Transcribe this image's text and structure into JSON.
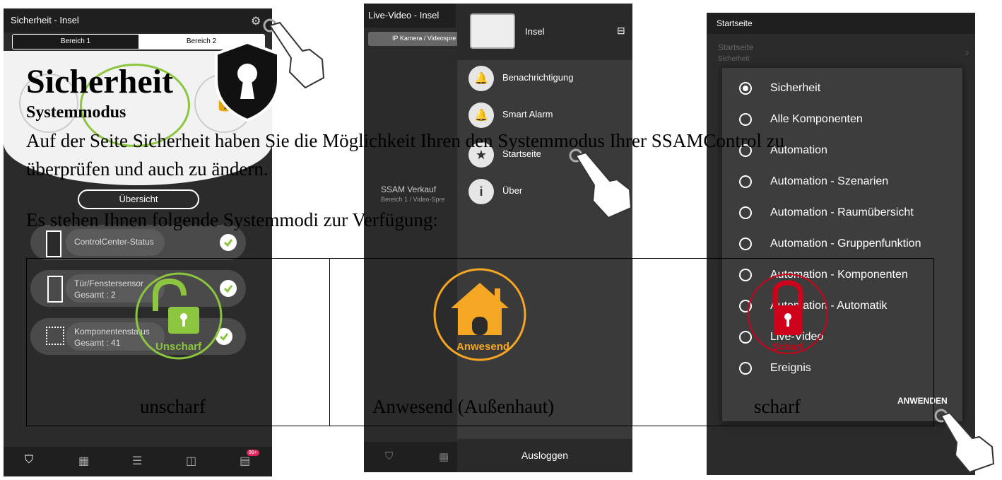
{
  "panel1": {
    "title": "Sicherheit - Insel",
    "tab1": "Bereich 1",
    "tab2": "Bereich 2",
    "overview_button": "Übersicht",
    "rows": [
      {
        "label": "ControlCenter-Status",
        "sub": ""
      },
      {
        "label": "Tür/Fenstersensor",
        "sub": "Gesamt : 2"
      },
      {
        "label": "Komponentenstatus",
        "sub": "Gesamt : 41"
      }
    ],
    "mode_label": "Unscharf",
    "badge": "99+"
  },
  "panel2": {
    "title": "Live-Video - Insel",
    "tab": "IP Kamera / Videospre",
    "device_name": "Insel",
    "menu": [
      "Benachrichtigung",
      "Smart Alarm",
      "Startseite",
      "Über"
    ],
    "list_title": "SSAM Verkauf",
    "list_sub": "Bereich 1 / Video-Spre",
    "mode_label": "Anwesend",
    "logout": "Ausloggen"
  },
  "panel3": {
    "title": "Startseite",
    "row_title": "Startseite",
    "row_sub": "Sicherheit",
    "options": [
      "Sicherheit",
      "Alle Komponenten",
      "Automation",
      "Automation - Szenarien",
      "Automation - Raumübersicht",
      "Automation - Gruppenfunktion",
      "Automation - Komponenten",
      "Automation - Automatik",
      "Live-Video",
      "Ereignis"
    ],
    "selected_index": 0,
    "apply": "ANWENDEN",
    "mode_label": "Scharf"
  },
  "doc": {
    "heading": "Sicherheit",
    "subheading": "Systemmodus",
    "para1_line1": "Auf der Seite Sicherheit haben Sie die Möglichkeit Ihren den Systemmodus Ihrer SSAMControl zu",
    "para1_line2": "überprüfen und auch zu ändern.",
    "para2": "Es stehen Ihnen folgende Systemmodi zur Verfügung:",
    "col1": "unscharf",
    "col2": "Anwesend (Außenhaut)",
    "col3": "scharf"
  },
  "colors": {
    "green": "#8cc63f",
    "orange": "#f5a623",
    "red": "#d0021b",
    "dark_bg": "#2b2b2b"
  }
}
